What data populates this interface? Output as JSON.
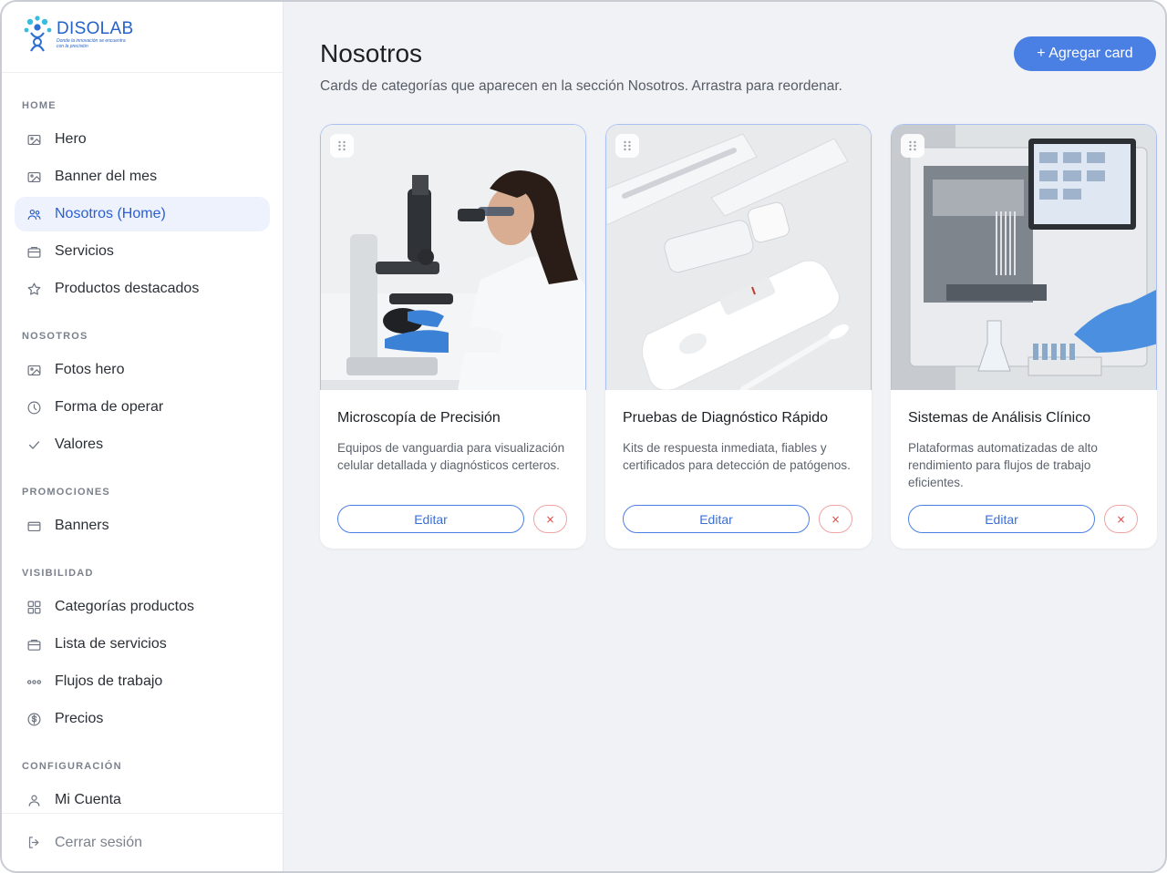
{
  "brand": {
    "name": "DISOLAB",
    "tagline": "Donde la innovación se encuentra con la precisión"
  },
  "sidebar": {
    "sections": [
      {
        "title": "HOME",
        "items": [
          {
            "label": "Hero",
            "icon": "image-icon"
          },
          {
            "label": "Banner del mes",
            "icon": "image-icon"
          },
          {
            "label": "Nosotros (Home)",
            "icon": "users-icon",
            "active": true
          },
          {
            "label": "Servicios",
            "icon": "briefcase-icon"
          },
          {
            "label": "Productos destacados",
            "icon": "star-icon"
          }
        ]
      },
      {
        "title": "NOSOTROS",
        "items": [
          {
            "label": "Fotos hero",
            "icon": "image-icon"
          },
          {
            "label": "Forma de operar",
            "icon": "clock-icon"
          },
          {
            "label": "Valores",
            "icon": "check-icon"
          }
        ]
      },
      {
        "title": "PROMOCIONES",
        "items": [
          {
            "label": "Banners",
            "icon": "card-icon"
          }
        ]
      },
      {
        "title": "VISIBILIDAD",
        "items": [
          {
            "label": "Categorías productos",
            "icon": "grid-icon"
          },
          {
            "label": "Lista de servicios",
            "icon": "briefcase-icon"
          },
          {
            "label": "Flujos de trabajo",
            "icon": "dots-icon"
          },
          {
            "label": "Precios",
            "icon": "dollar-icon"
          }
        ]
      },
      {
        "title": "CONFIGURACIÓN",
        "items": [
          {
            "label": "Mi Cuenta",
            "icon": "user-icon"
          }
        ]
      }
    ],
    "logout_label": "Cerrar sesión"
  },
  "header": {
    "title": "Nosotros",
    "subtitle": "Cards de categorías que aparecen en la sección Nosotros. Arrastra para reordenar.",
    "add_button": "+ Agregar card"
  },
  "cards": [
    {
      "title": "Microscopía de Precisión",
      "description": "Equipos de vanguardia para visualización celular detallada y diagnósticos certeros.",
      "edit_label": "Editar",
      "delete_label": "×"
    },
    {
      "title": "Pruebas de Diagnóstico Rápido",
      "description": "Kits de respuesta inmediata, fiables y certificados para detección de patógenos.",
      "edit_label": "Editar",
      "delete_label": "×"
    },
    {
      "title": "Sistemas de Análisis Clínico",
      "description": "Plataformas automatizadas de alto rendimiento para flujos de trabajo eficientes.",
      "edit_label": "Editar",
      "delete_label": "×"
    }
  ],
  "colors": {
    "accent": "#4a7fe4",
    "active_bg": "#edf2fc",
    "danger": "#e04545"
  }
}
